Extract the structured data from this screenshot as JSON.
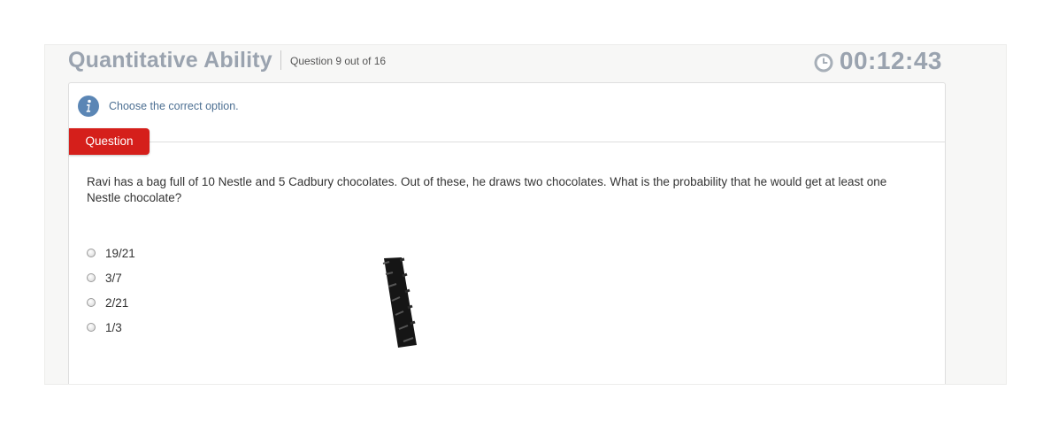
{
  "header": {
    "section_title": "Quantitative Ability",
    "question_count": "Question 9 out of 16",
    "timer": "00:12:43",
    "timer_icon": "clock-icon"
  },
  "instruction": {
    "icon": "info-icon",
    "text": "Choose the correct option."
  },
  "question": {
    "tab_label": "Question",
    "text": "Ravi has a bag full of 10 Nestle and 5 Cadbury chocolates. Out of these, he draws two chocolates. What is the probability that he would get at least one Nestle chocolate?",
    "options": [
      "19/21",
      "3/7",
      "2/21",
      "1/3"
    ],
    "selected": null
  },
  "colors": {
    "accent_red": "#d51f1b",
    "title_gray": "#9aa3af",
    "info_blue": "#4c6f92"
  }
}
